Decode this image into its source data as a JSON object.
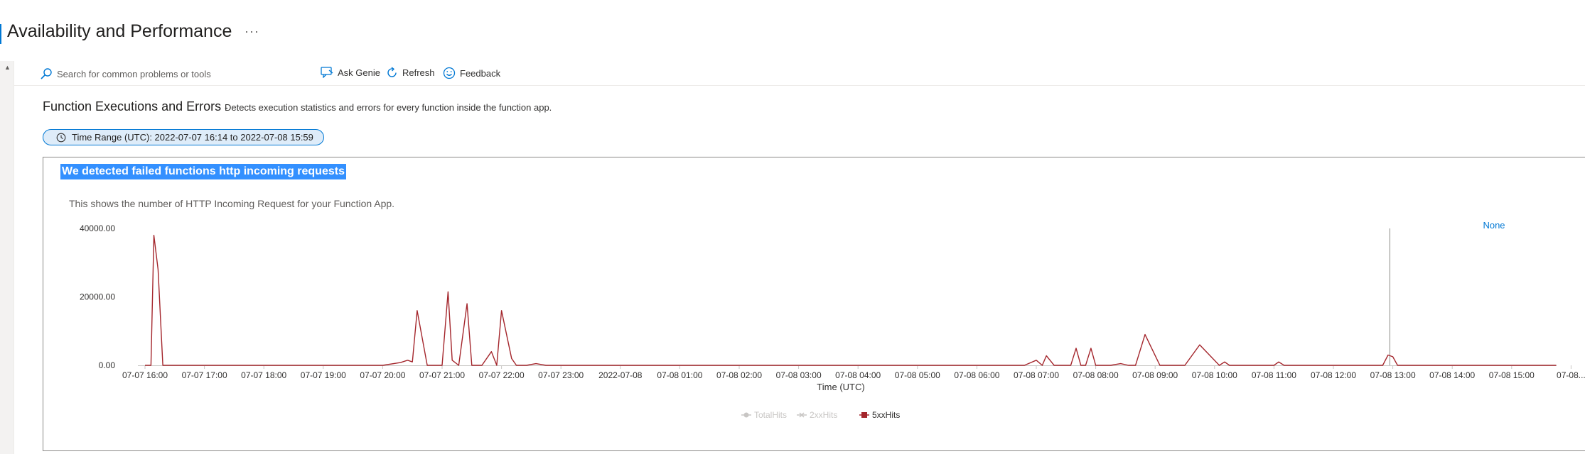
{
  "page": {
    "title": "Availability and Performance",
    "more_icon": "more-icon",
    "accent_color": "#0078d4"
  },
  "toolbar": {
    "search_placeholder": "Search for common problems or tools",
    "ask_genie_label": "Ask Genie",
    "refresh_label": "Refresh",
    "feedback_label": "Feedback",
    "icons": [
      "search-icon",
      "genie-icon",
      "refresh-icon",
      "feedback-icon"
    ]
  },
  "section": {
    "title": "Function Executions and Errors",
    "separator": "-",
    "description": "Detects execution statistics and errors for every function inside the function app.",
    "time_range": "Time Range (UTC): 2022-07-07 16:14 to 2022-07-08 15:59"
  },
  "card": {
    "title": "We detected failed functions http incoming requests",
    "description": "This shows the number of HTTP Incoming Request for your Function App."
  },
  "chart_data": {
    "type": "line",
    "title": "",
    "xlabel": "Time (UTC)",
    "ylabel": "",
    "y_ticks": [
      "0.00",
      "20000.00",
      "40000.00"
    ],
    "ylim": [
      0,
      40000
    ],
    "x_ticks": [
      "07-07 16:00",
      "07-07 17:00",
      "07-07 18:00",
      "07-07 19:00",
      "07-07 20:00",
      "07-07 21:00",
      "07-07 22:00",
      "07-07 23:00",
      "2022-07-08",
      "07-08 01:00",
      "07-08 02:00",
      "07-08 03:00",
      "07-08 04:00",
      "07-08 05:00",
      "07-08 06:00",
      "07-08 07:00",
      "07-08 08:00",
      "07-08 09:00",
      "07-08 10:00",
      "07-08 11:00",
      "07-08 12:00",
      "07-08 13:00",
      "07-08 14:00",
      "07-08 15:00",
      "07-08..."
    ],
    "tooltip_label": "None",
    "legend": {
      "placement": "bottom",
      "entries": [
        {
          "name": "TotalHits",
          "color": "#c8c6c4",
          "enabled": false
        },
        {
          "name": "2xxHits",
          "color": "#c8c6c4",
          "enabled": false
        },
        {
          "name": "5xxHits",
          "color": "#a4262c",
          "enabled": true
        }
      ]
    },
    "series": [
      {
        "name": "5xxHits",
        "color": "#a4262c",
        "x_hours": [
          0,
          0.1,
          0.15,
          0.22,
          0.3,
          0.38,
          0.5,
          4.0,
          4.3,
          4.42,
          4.5,
          4.58,
          4.75,
          5.0,
          5.1,
          5.17,
          5.28,
          5.42,
          5.5,
          5.58,
          5.67,
          5.83,
          5.92,
          6.0,
          6.17,
          6.25,
          6.33,
          6.42,
          6.58,
          6.75,
          6.83,
          6.92,
          14.8,
          15.0,
          15.1,
          15.17,
          15.3,
          15.5,
          15.58,
          15.67,
          15.75,
          15.83,
          15.92,
          16.0,
          16.25,
          16.42,
          16.55,
          16.67,
          16.83,
          17.08,
          17.17,
          17.25,
          17.33,
          17.5,
          17.75,
          18.08,
          18.17,
          18.25,
          18.33,
          18.58,
          18.83,
          19.0,
          19.08,
          19.17,
          19.33,
          19.6,
          20.17,
          20.5,
          20.83,
          20.92,
          21.0,
          21.08,
          21.17,
          21.33,
          21.6,
          22.0,
          23.0,
          23.75
        ],
        "values": [
          0,
          0,
          38000,
          28000,
          0,
          0,
          0,
          0,
          800,
          1500,
          1000,
          16000,
          0,
          0,
          21500,
          1500,
          0,
          18000,
          0,
          0,
          0,
          4000,
          0,
          16000,
          2000,
          0,
          0,
          0,
          500,
          0,
          0,
          0,
          0,
          1500,
          0,
          2800,
          0,
          0,
          0,
          5000,
          0,
          0,
          5000,
          0,
          0,
          500,
          0,
          0,
          9000,
          0,
          0,
          0,
          0,
          0,
          6000,
          0,
          1000,
          0,
          0,
          0,
          0,
          0,
          1000,
          0,
          0,
          0,
          0,
          0,
          0,
          3000,
          2500,
          0,
          0,
          0,
          0,
          0,
          0,
          0
        ]
      },
      {
        "name": "TotalHits",
        "color": "#c8c6c4",
        "values": []
      },
      {
        "name": "2xxHits",
        "color": "#c8c6c4",
        "values": []
      }
    ],
    "cursor_x_hour": 20.95,
    "grid": false
  }
}
